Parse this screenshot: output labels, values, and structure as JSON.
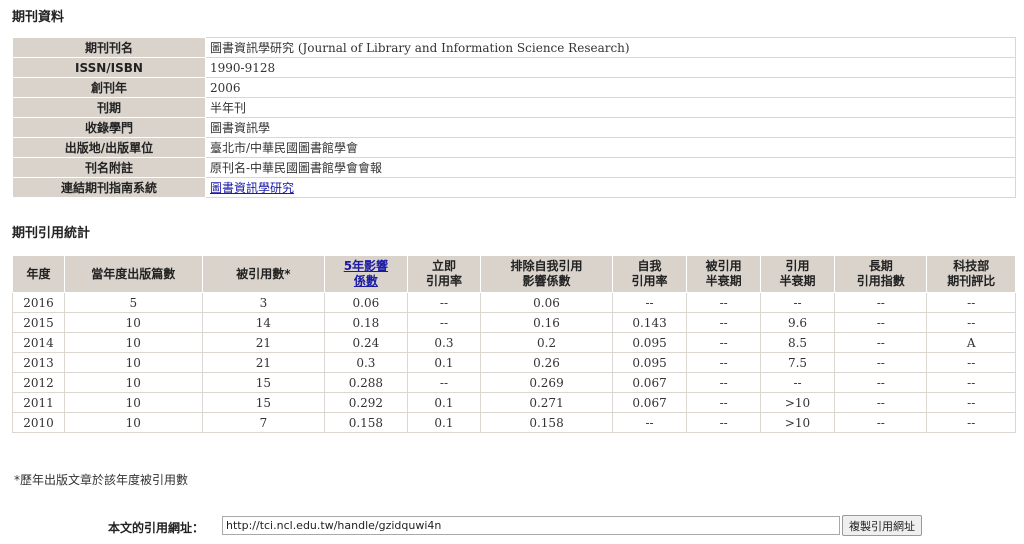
{
  "journal_info": {
    "title": "期刊資料",
    "rows": [
      {
        "label": "期刊刊名",
        "value": "圖書資訊學研究 (Journal of Library and Information Science Research)"
      },
      {
        "label": "ISSN/ISBN",
        "value": "1990-9128"
      },
      {
        "label": "創刊年",
        "value": "2006"
      },
      {
        "label": "刊期",
        "value": "半年刊"
      },
      {
        "label": "收錄學門",
        "value": "圖書資訊學"
      },
      {
        "label": "出版地/出版單位",
        "value": "臺北市/中華民國圖書館學會"
      },
      {
        "label": "刊名附註",
        "value": "原刊名-中華民國圖書館學會會報"
      },
      {
        "label": "連結期刊指南系統",
        "value": "圖書資訊學研究"
      }
    ]
  },
  "citation_stats": {
    "title": "期刊引用統計",
    "headers": [
      {
        "line1": "年度",
        "line2": ""
      },
      {
        "line1": "當年度出版篇數",
        "line2": ""
      },
      {
        "line1": "被引用數*",
        "line2": ""
      },
      {
        "line1": "5年影響",
        "line2": "係數"
      },
      {
        "line1": "立即",
        "line2": "引用率"
      },
      {
        "line1": "排除自我引用",
        "line2": "影響係數"
      },
      {
        "line1": "自我",
        "line2": "引用率"
      },
      {
        "line1": "被引用",
        "line2": "半衰期"
      },
      {
        "line1": "引用",
        "line2": "半衰期"
      },
      {
        "line1": "長期",
        "line2": "引用指數"
      },
      {
        "line1": "科技部",
        "line2": "期刊評比"
      }
    ],
    "rows": [
      [
        "2016",
        "5",
        "3",
        "0.06",
        "--",
        "0.06",
        "--",
        "--",
        "--",
        "--",
        "--"
      ],
      [
        "2015",
        "10",
        "14",
        "0.18",
        "--",
        "0.16",
        "0.143",
        "--",
        "9.6",
        "--",
        "--"
      ],
      [
        "2014",
        "10",
        "21",
        "0.24",
        "0.3",
        "0.2",
        "0.095",
        "--",
        "8.5",
        "--",
        "A"
      ],
      [
        "2013",
        "10",
        "21",
        "0.3",
        "0.1",
        "0.26",
        "0.095",
        "--",
        "7.5",
        "--",
        "--"
      ],
      [
        "2012",
        "10",
        "15",
        "0.288",
        "--",
        "0.269",
        "0.067",
        "--",
        "--",
        "--",
        "--"
      ],
      [
        "2011",
        "10",
        "15",
        "0.292",
        "0.1",
        "0.271",
        "0.067",
        "--",
        ">10",
        "--",
        "--"
      ],
      [
        "2010",
        "10",
        "7",
        "0.158",
        "0.1",
        "0.158",
        "--",
        "--",
        ">10",
        "--",
        "--"
      ]
    ]
  },
  "footnote": "*歷年出版文章於該年度被引用數",
  "citation_url": {
    "label": "本文的引用網址：",
    "value": "http://tci.ncl.edu.tw/handle/gzidquwi4n",
    "copy_button": "複製引用網址"
  }
}
